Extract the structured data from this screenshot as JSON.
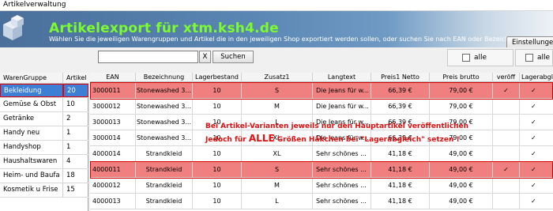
{
  "window": {
    "title": "Artikelverwaltung"
  },
  "header": {
    "title": "Artikelexport für xtm.ksh4.de",
    "subtitle": "Wählen Sie die jeweiligen Warengruppen und Artikel die in den jeweiligen Shop exportiert werden sollen, oder suchen Sie nach EAN oder Bezeichnung",
    "settings_label": "Einstellungen"
  },
  "search": {
    "value": "",
    "clear_label": "X",
    "button_label": "Suchen"
  },
  "alle": {
    "label1": "alle",
    "label2": "alle"
  },
  "groups": {
    "headers": [
      "WarenGruppe",
      "Artikel"
    ],
    "rows": [
      {
        "name": "Bekleidung",
        "count": "20"
      },
      {
        "name": "Gemüse & Obst",
        "count": "10"
      },
      {
        "name": "Getränke",
        "count": "2"
      },
      {
        "name": "Handy neu",
        "count": "1"
      },
      {
        "name": "Handyshop",
        "count": "1"
      },
      {
        "name": "Haushaltswaren",
        "count": "4"
      },
      {
        "name": "Heim- und Baufa",
        "count": "18"
      },
      {
        "name": "Kosmetik u Frise",
        "count": "15"
      }
    ]
  },
  "articles": {
    "headers": [
      "EAN",
      "Bezeichnung",
      "Lagerbestand",
      "Zusatz1",
      "Langtext",
      "Preis1 Netto",
      "Preis brutto",
      "veröff",
      "Lagerabgl"
    ],
    "rows": [
      {
        "ean": "3000011",
        "bez": "Stonewashed 3...",
        "lager": "10",
        "zusatz": "S",
        "lang": "Die Jeans für w...",
        "netto": "66,39 €",
        "brutto": "79,00 €",
        "veroeff": "✓",
        "abgl": "✓",
        "hl": true
      },
      {
        "ean": "3000012",
        "bez": "Stonewashed 3...",
        "lager": "10",
        "zusatz": "M",
        "lang": "Die Jeans für w...",
        "netto": "66,39 €",
        "brutto": "79,00 €",
        "veroeff": "",
        "abgl": "✓",
        "hl": false
      },
      {
        "ean": "3000013",
        "bez": "Stonewashed 3...",
        "lager": "10",
        "zusatz": "L",
        "lang": "Die Jeans für w...",
        "netto": "66,39 €",
        "brutto": "79,00 €",
        "veroeff": "",
        "abgl": "✓",
        "hl": false
      },
      {
        "ean": "3000014",
        "bez": "Stonewashed 3...",
        "lager": "10",
        "zusatz": "XL",
        "lang": "Die Jeans für w...",
        "netto": "66,39 €",
        "brutto": "79,00 €",
        "veroeff": "",
        "abgl": "✓",
        "hl": false
      },
      {
        "ean": "4000014",
        "bez": "Strandkleid",
        "lager": "10",
        "zusatz": "XL",
        "lang": "Sehr schönes ...",
        "netto": "41,18 €",
        "brutto": "49,00 €",
        "veroeff": "",
        "abgl": "✓",
        "hl": false
      },
      {
        "ean": "4000011",
        "bez": "Strandkleid",
        "lager": "10",
        "zusatz": "S",
        "lang": "Sehr schönes ...",
        "netto": "41,18 €",
        "brutto": "49,00 €",
        "veroeff": "✓",
        "abgl": "✓",
        "hl": true
      },
      {
        "ean": "4000012",
        "bez": "Strandkleid",
        "lager": "10",
        "zusatz": "M",
        "lang": "Sehr schönes ...",
        "netto": "41,18 €",
        "brutto": "49,00 €",
        "veroeff": "",
        "abgl": "✓",
        "hl": false
      },
      {
        "ean": "4000013",
        "bez": "Strandkleid",
        "lager": "10",
        "zusatz": "L",
        "lang": "Sehr schönes ...",
        "netto": "41,18 €",
        "brutto": "49,00 €",
        "veroeff": "",
        "abgl": "✓",
        "hl": false
      }
    ]
  },
  "notice": {
    "line1": "Bei Artikel-Varianten jeweils nur den Hauptartikel veröffentlichen",
    "line2_pre": "Jedoch für ",
    "line2_big": "ALLE",
    "line2_post": " Größen Häkchen bei \"Lagerabgleich\" setzen !"
  },
  "colors": {
    "title_green": "#7CFC2E",
    "highlight_row": "#f08080",
    "highlight_border": "#d40000",
    "selection": "#3d7fd4",
    "notice_red": "#e01010"
  }
}
